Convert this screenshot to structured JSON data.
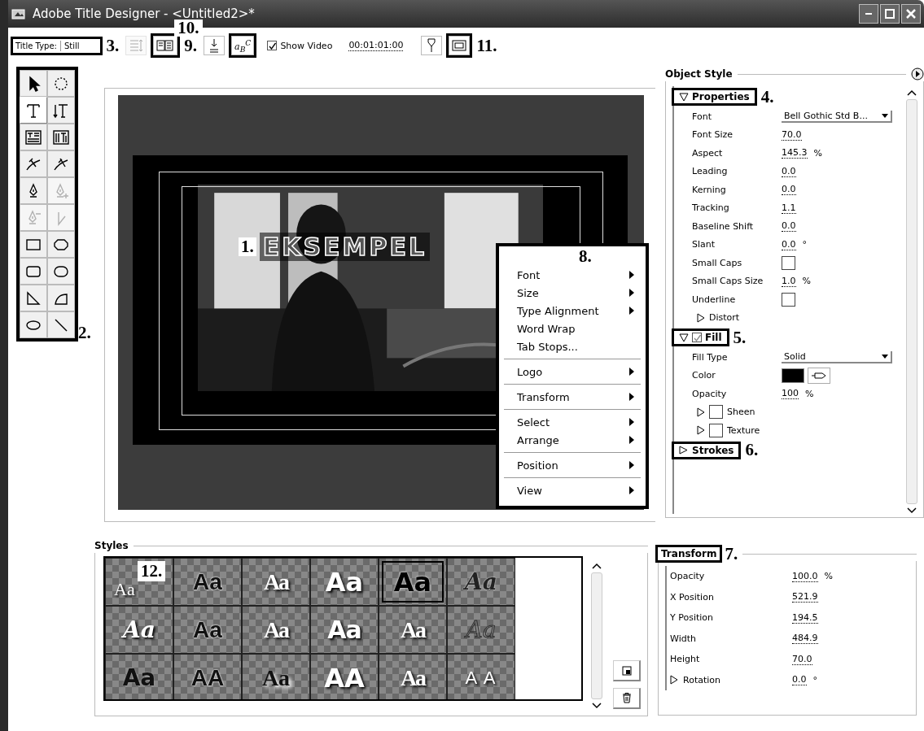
{
  "window": {
    "title": "Adobe Title Designer - <Untitled2>*"
  },
  "toolbar": [
    {
      "kind": "title-type",
      "label": "Title Type:",
      "value": "Still",
      "boxed": true
    },
    {
      "kind": "callout",
      "text": "3."
    },
    {
      "kind": "tab-stops",
      "disabled": true,
      "boxed": false
    },
    {
      "kind": "templates",
      "boxed": true,
      "callout": "10.",
      "disabled": false
    },
    {
      "kind": "callout",
      "text": "9."
    },
    {
      "kind": "baseline",
      "boxed": false,
      "disabled": false
    },
    {
      "kind": "small-caps",
      "boxed": true,
      "text": "a$_{B}$$^{C}$"
    },
    {
      "kind": "show-video",
      "label": "Show Video",
      "checked": true
    },
    {
      "kind": "timecode",
      "value": "00:01:01:00"
    },
    {
      "kind": "marker",
      "boxed": false,
      "disabled": false
    },
    {
      "kind": "safe-margins",
      "boxed": true,
      "disabled": false
    },
    {
      "kind": "callout",
      "text": "11."
    }
  ],
  "tools": {
    "callout": "2.",
    "items": [
      {
        "kind": "select",
        "selected": false,
        "disabled": false
      },
      {
        "kind": "rotate",
        "selected": false,
        "disabled": false
      },
      {
        "kind": "type",
        "selected": true,
        "disabled": false
      },
      {
        "kind": "vertical-type",
        "selected": false,
        "disabled": false
      },
      {
        "kind": "area-type",
        "selected": false,
        "disabled": false
      },
      {
        "kind": "vertical-area-type",
        "selected": false,
        "disabled": false
      },
      {
        "kind": "path-type",
        "selected": false,
        "disabled": false
      },
      {
        "kind": "vertical-path-type",
        "selected": false,
        "disabled": false
      },
      {
        "kind": "pen",
        "selected": false,
        "disabled": false
      },
      {
        "kind": "add-anchor",
        "selected": false,
        "disabled": true
      },
      {
        "kind": "delete-anchor",
        "selected": false,
        "disabled": true
      },
      {
        "kind": "convert-anchor",
        "selected": false,
        "disabled": true
      },
      {
        "kind": "rectangle",
        "selected": false,
        "disabled": false
      },
      {
        "kind": "clipped-rectangle",
        "selected": false,
        "disabled": false
      },
      {
        "kind": "rounded-rectangle",
        "selected": false,
        "disabled": false
      },
      {
        "kind": "rounded-corner-rectangle",
        "selected": false,
        "disabled": false
      },
      {
        "kind": "wedge",
        "selected": false,
        "disabled": false
      },
      {
        "kind": "arc",
        "selected": false,
        "disabled": false
      },
      {
        "kind": "ellipse",
        "selected": false,
        "disabled": false
      },
      {
        "kind": "line",
        "selected": false,
        "disabled": false
      }
    ]
  },
  "canvas": {
    "title_text": "EKSEMPEL",
    "callout": "1."
  },
  "context_menu": {
    "callout": "8.",
    "groups": [
      [
        {
          "label": "Font",
          "submenu": true
        },
        {
          "label": "Size",
          "submenu": true
        },
        {
          "label": "Type Alignment",
          "submenu": true
        },
        {
          "label": "Word Wrap",
          "submenu": false
        },
        {
          "label": "Tab Stops...",
          "submenu": false
        }
      ],
      [
        {
          "label": "Logo",
          "submenu": true
        }
      ],
      [
        {
          "label": "Transform",
          "submenu": true
        }
      ],
      [
        {
          "label": "Select",
          "submenu": true
        },
        {
          "label": "Arrange",
          "submenu": true
        }
      ],
      [
        {
          "label": "Position",
          "submenu": true
        }
      ],
      [
        {
          "label": "View",
          "submenu": true
        }
      ]
    ]
  },
  "object_style": {
    "title": "Object Style",
    "sections": [
      {
        "title": "Properties",
        "expanded": true,
        "boxed": true,
        "callout": "4.",
        "rows": [
          {
            "kind": "dropdown",
            "label": "Font",
            "value": "Bell Gothic Std B..."
          },
          {
            "kind": "number",
            "label": "Font Size",
            "value": "70.0"
          },
          {
            "kind": "number",
            "label": "Aspect",
            "value": "145.3",
            "unit": "%"
          },
          {
            "kind": "number",
            "label": "Leading",
            "value": "0.0"
          },
          {
            "kind": "number",
            "label": "Kerning",
            "value": "0.0"
          },
          {
            "kind": "number",
            "label": "Tracking",
            "value": "1.1"
          },
          {
            "kind": "number",
            "label": "Baseline Shift",
            "value": "0.0"
          },
          {
            "kind": "number",
            "label": "Slant",
            "value": "0.0",
            "unit": "°"
          },
          {
            "kind": "checkbox",
            "label": "Small Caps",
            "checked": false
          },
          {
            "kind": "number",
            "label": "Small Caps Size",
            "value": "1.0",
            "unit": "%"
          },
          {
            "kind": "checkbox",
            "label": "Underline",
            "checked": false
          },
          {
            "kind": "expander",
            "label": "Distort"
          }
        ]
      },
      {
        "title": "Fill",
        "expanded": true,
        "boxed": true,
        "checked": true,
        "callout": "5.",
        "rows": [
          {
            "kind": "dropdown",
            "label": "Fill Type",
            "value": "Solid"
          },
          {
            "kind": "color",
            "label": "Color",
            "color": "#000000"
          },
          {
            "kind": "number",
            "label": "Opacity",
            "value": "100",
            "unit": "%"
          },
          {
            "kind": "option",
            "label": "Sheen",
            "checked": false
          },
          {
            "kind": "option",
            "label": "Texture",
            "checked": false
          }
        ]
      },
      {
        "title": "Strokes",
        "expanded": false,
        "boxed": true,
        "callout": "6."
      }
    ]
  },
  "styles": {
    "title": "Styles",
    "callout": "12.",
    "swatches": [
      {
        "text": "Aa",
        "kind": "plain",
        "selected": false
      },
      {
        "text": "Aa",
        "kind": "outline",
        "selected": false
      },
      {
        "text": "Aa",
        "kind": "condensed",
        "selected": false
      },
      {
        "text": "Aa",
        "kind": "heavy",
        "selected": false
      },
      {
        "text": "Aa",
        "kind": "heavy-dark",
        "selected": true
      },
      {
        "text": "Aa",
        "kind": "script",
        "selected": false
      },
      {
        "text": "Aa",
        "kind": "script-light",
        "selected": false
      },
      {
        "text": "Aa",
        "kind": "outline",
        "selected": false
      },
      {
        "text": "Aa",
        "kind": "condensed",
        "selected": false
      },
      {
        "text": "Aa",
        "kind": "wide",
        "selected": false
      },
      {
        "text": "Aa",
        "kind": "condensed",
        "selected": false
      },
      {
        "text": "Aa",
        "kind": "hollow",
        "selected": false
      },
      {
        "text": "Aa",
        "kind": "round",
        "selected": false
      },
      {
        "text": "AA",
        "kind": "outline",
        "selected": false
      },
      {
        "text": "Aa",
        "kind": "serif",
        "selected": false
      },
      {
        "text": "AA",
        "kind": "heavy",
        "selected": false
      },
      {
        "text": "Aa",
        "kind": "condensed",
        "selected": false
      },
      {
        "text": "A A",
        "kind": "spaced",
        "selected": false
      }
    ]
  },
  "transform": {
    "title": "Transform",
    "boxed": true,
    "callout": "7.",
    "rows": [
      {
        "kind": "number",
        "label": "Opacity",
        "value": "100.0",
        "unit": "%"
      },
      {
        "kind": "number",
        "label": "X Position",
        "value": "521.9"
      },
      {
        "kind": "number",
        "label": "Y Position",
        "value": "194.5"
      },
      {
        "kind": "number",
        "label": "Width",
        "value": "484.9"
      },
      {
        "kind": "number",
        "label": "Height",
        "value": "70.0"
      },
      {
        "kind": "expander",
        "label": "Rotation",
        "value": "0.0",
        "unit": "°"
      }
    ]
  }
}
